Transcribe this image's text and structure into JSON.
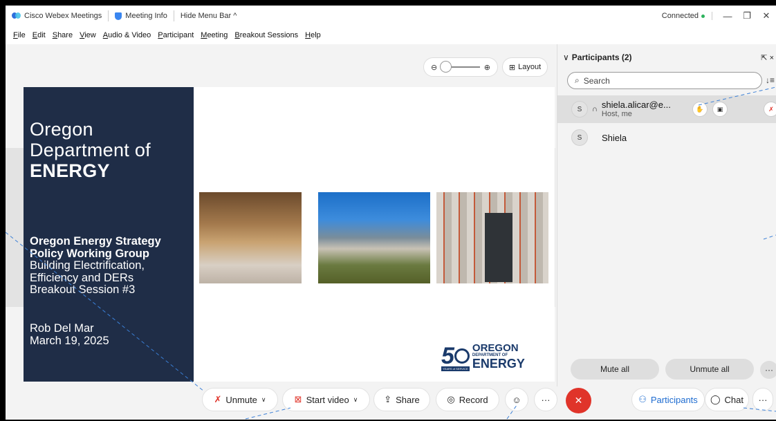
{
  "titlebar": {
    "app_name": "Cisco Webex Meetings",
    "meeting_info": "Meeting Info",
    "hide_menu": "Hide Menu Bar ^",
    "status": "Connected",
    "minimize": "—",
    "restore": "❐",
    "close": "✕"
  },
  "menu": [
    "File",
    "Edit",
    "Share",
    "View",
    "Audio & Video",
    "Participant",
    "Meeting",
    "Breakout Sessions",
    "Help"
  ],
  "stage": {
    "zoom_out": "⊖",
    "zoom_in": "⊕",
    "layout_icon": "⊞",
    "layout_label": "Layout"
  },
  "slide": {
    "org_line1": "Oregon",
    "org_line2": "Department of",
    "org_line3": "ENERGY",
    "title_line1": "Oregon Energy Strategy",
    "title_line2": "Policy Working Group",
    "sub_line1": "Building Electrification,",
    "sub_line2": "Efficiency and DERs",
    "sub_line3": "Breakout Session #3",
    "presenter": "Rob Del Mar",
    "date": "March 19, 2025",
    "logo_number": "5",
    "logo_state": "OREGON",
    "logo_dept": "DEPARTMENT OF",
    "logo_energy": "ENERGY",
    "logo_years": "YEARS of SERVICE"
  },
  "participants": {
    "header": "Participants (2)",
    "search_placeholder": "Search",
    "sort_icon": "↓≡",
    "popout_icon": "⇱ ×",
    "rows": [
      {
        "initial": "S",
        "name": "shiela.alicar@e...",
        "role": "Host, me"
      },
      {
        "initial": "S",
        "name": "Shiela",
        "role": ""
      }
    ],
    "mute_all": "Mute all",
    "unmute_all": "Unmute all",
    "more": "···"
  },
  "toolbar": {
    "unmute": "Unmute",
    "start_video": "Start video",
    "share": "Share",
    "record": "Record",
    "reactions": "☺",
    "more": "···",
    "end": "✕",
    "participants": "Participants",
    "chat": "Chat",
    "more_right": "···"
  },
  "colors": {
    "slide_navy": "#1f2d47",
    "end_red": "#e0342a",
    "active_blue": "#1d6bd0",
    "connected_green": "#2db35d"
  }
}
